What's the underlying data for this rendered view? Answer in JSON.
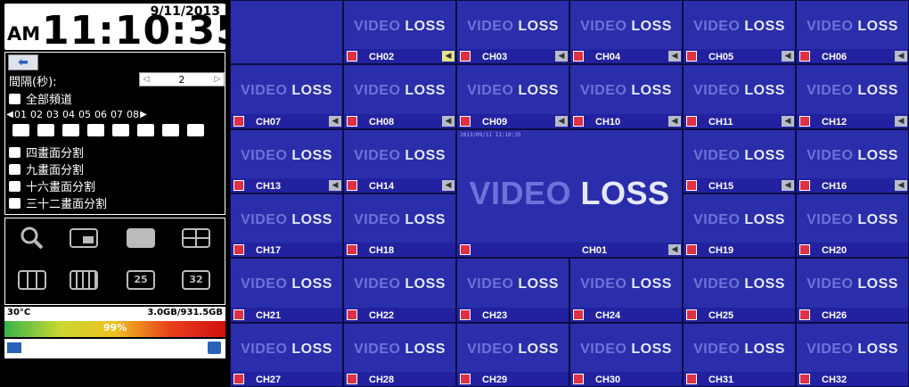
{
  "clock": {
    "date": "9/11/2013",
    "ampm": "AM",
    "time": "11:10:35"
  },
  "sequence": {
    "interval_label": "間隔(秒):",
    "interval_value": "2",
    "options": [
      "全部頻道",
      "四畫面分割",
      "九畫面分割",
      "十六畫面分割",
      "三十二畫面分割"
    ],
    "channels": [
      "01",
      "02",
      "03",
      "04",
      "05",
      "06",
      "07",
      "08"
    ]
  },
  "status": {
    "temp": "30°C",
    "disk": "3.0GB/931.5GB",
    "disk_percent": "99%"
  },
  "grid": {
    "video_loss_a": "VIDEO",
    "video_loss_b": "LOSS",
    "main_stamp": "2013/09/11 11:10:35",
    "tiles": [
      "CH02",
      "CH03",
      "CH04",
      "CH05",
      "CH06",
      "CH07",
      "CH08",
      "CH09",
      "CH10",
      "CH11",
      "CH12",
      "CH13",
      "CH14",
      "CH15",
      "CH16",
      "CH17",
      "CH18",
      "CH19",
      "CH20",
      "CH21",
      "CH22",
      "CH23",
      "CH24",
      "CH25",
      "CH26",
      "CH27",
      "CH28",
      "CH29",
      "CH30",
      "CH31",
      "CH32"
    ],
    "main_channel": "CH01"
  }
}
